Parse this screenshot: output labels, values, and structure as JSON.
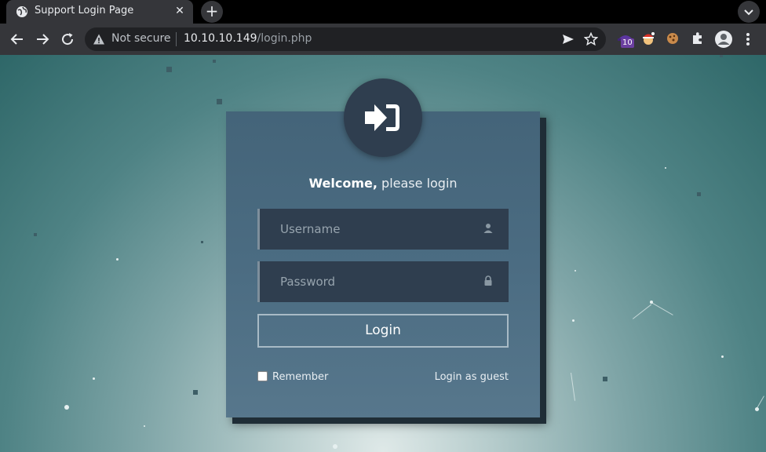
{
  "browser": {
    "tab_title": "Support Login Page",
    "close_glyph": "✕",
    "newtab_glyph": "+",
    "security_label": "Not secure",
    "url_host": "10.10.10.149",
    "url_path": "/login.php",
    "extension_badge": "10"
  },
  "login": {
    "welcome_bold": "Welcome,",
    "welcome_rest": "please login",
    "username_placeholder": "Username",
    "password_placeholder": "Password",
    "login_button": "Login",
    "remember_label": "Remember",
    "guest_link": "Login as guest",
    "remember_checked": false
  },
  "colors": {
    "card": "#4b6c82",
    "field": "#2f3e4f",
    "avatar": "#2f3e4f",
    "badge": "#6b3fa0"
  },
  "icons": {
    "tab": "globe-icon",
    "avatar": "sign-in-icon",
    "username": "user-icon",
    "password": "lock-icon"
  }
}
